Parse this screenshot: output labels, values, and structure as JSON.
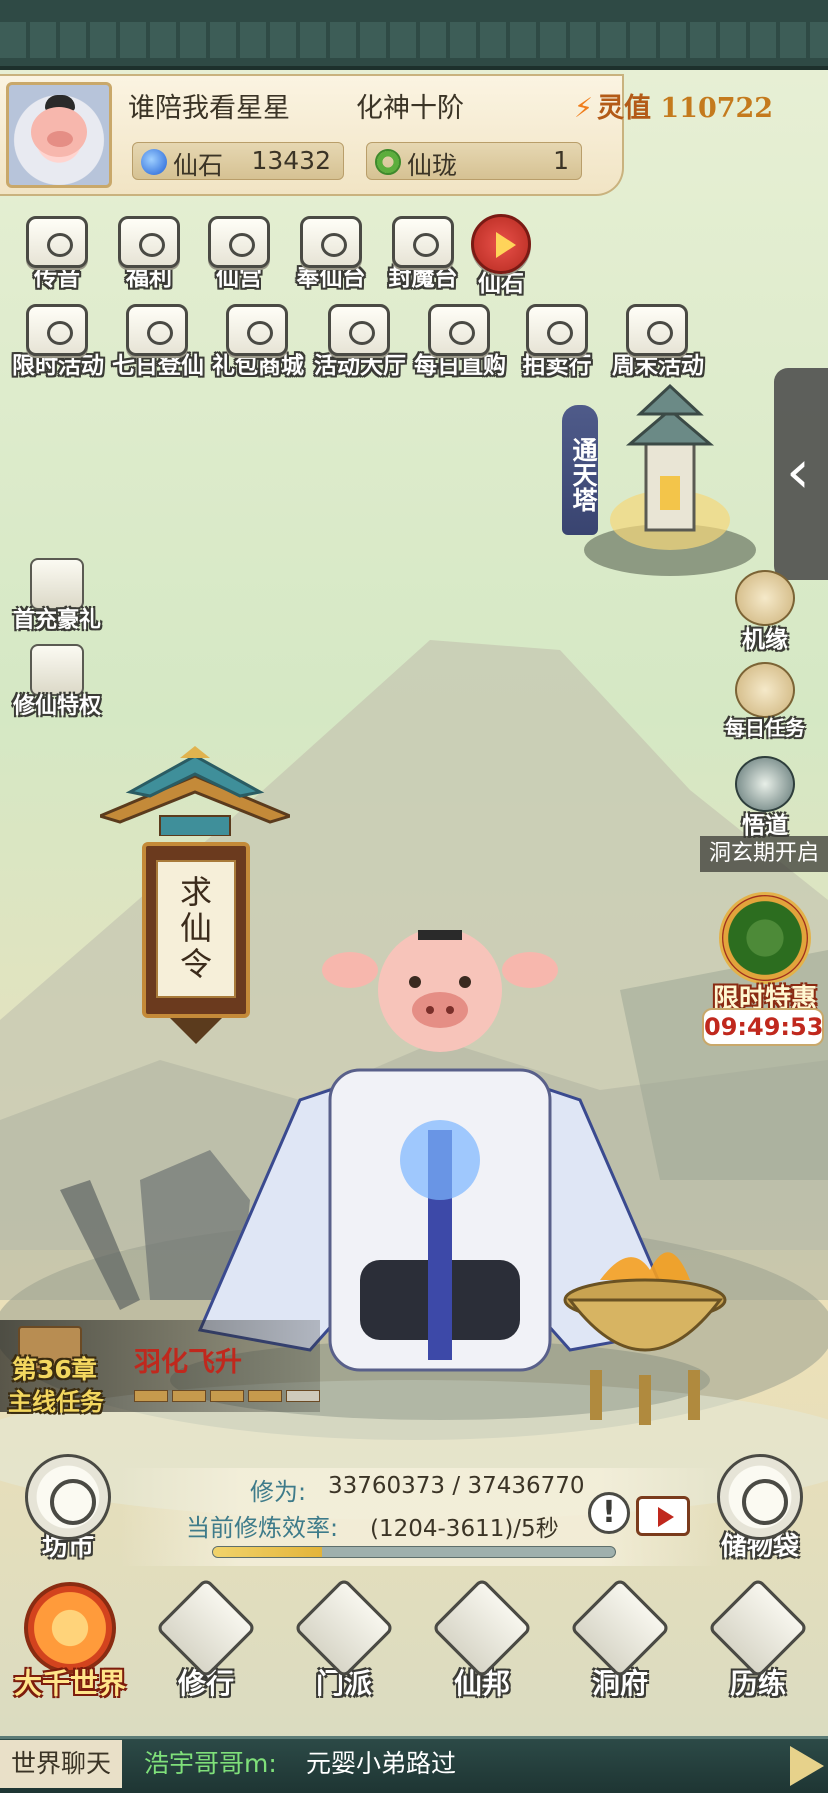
{
  "player": {
    "name": "谁陪我看星星",
    "rank": "化神十阶",
    "power_label": "灵值",
    "power_value": "110722"
  },
  "currencies": {
    "stone": {
      "label": "仙石",
      "value": "13432"
    },
    "jade": {
      "label": "仙珑",
      "value": "1"
    }
  },
  "top_row1": [
    "传音",
    "福利",
    "仙宫",
    "奉仙台",
    "封魔台",
    "仙石"
  ],
  "top_row2": [
    "限时活动",
    "七日登仙",
    "礼包商城",
    "活动大厅",
    "每日直购",
    "拍卖行",
    "周末活动"
  ],
  "tower": {
    "label": "通天塔"
  },
  "left_items": [
    "首充豪礼",
    "修仙特权"
  ],
  "right_items": {
    "fate": "机缘",
    "daily": "每日任务",
    "wudao": "悟道",
    "wudao_sub": "洞玄期开启",
    "offer": "限时特惠",
    "timer": "09:49:53"
  },
  "lantern": {
    "text": "求仙令"
  },
  "chapter": {
    "number": "第36章",
    "subtitle": "主线任务",
    "task": "羽化飞升",
    "progress_filled": 4,
    "progress_total": 5
  },
  "cultivation": {
    "label": "修为:",
    "value": "33760373 / 37436770",
    "rate_label": "当前修炼效率:",
    "rate_value": "(1204-3611)/5秒",
    "progress": 0.27
  },
  "side_round": {
    "market": "坊市",
    "bag": "储物袋"
  },
  "nav": [
    "大千世界",
    "修行",
    "门派",
    "仙邦",
    "洞府",
    "历练"
  ],
  "chat": {
    "label": "世界聊天",
    "sender": "浩宇哥哥m:",
    "message": "元婴小弟路过"
  },
  "colors": {
    "accent_gold": "#c47a1d",
    "timer_red": "#c0281d",
    "chat_name_green": "#7fe07a",
    "frame_dark": "#2f4a45"
  }
}
